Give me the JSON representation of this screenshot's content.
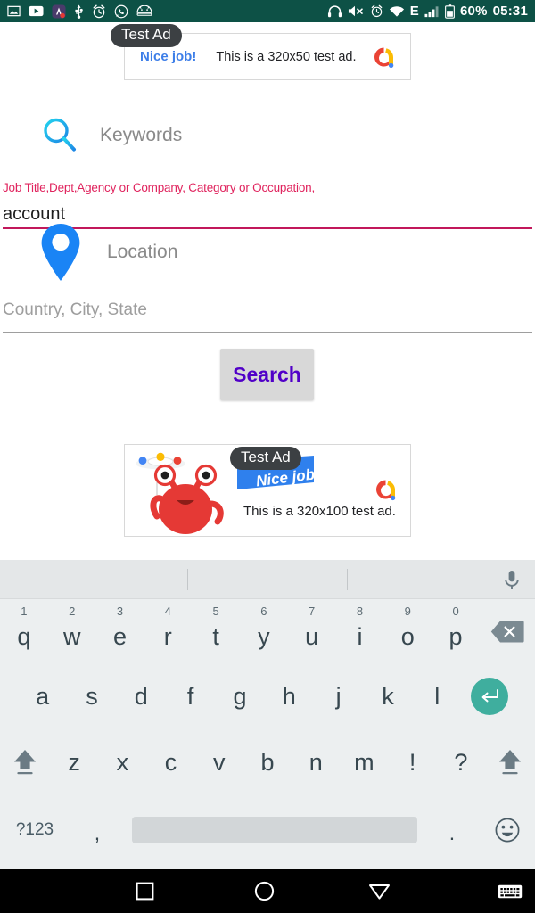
{
  "status_bar": {
    "background": "#0d5146",
    "left_icons": [
      "image-icon",
      "youtube-icon",
      "app-badge-icon",
      "usb-icon",
      "alarm-icon",
      "whatsapp-icon",
      "android-icon"
    ],
    "right_icons": [
      "headset-icon",
      "volume-mute-icon",
      "alarm-icon",
      "wifi-icon",
      "edge-network-icon",
      "signal-bars-icon",
      "battery-icon"
    ],
    "battery_percent": "60%",
    "clock": "05:31"
  },
  "ads": {
    "badge_label": "Test Ad",
    "top": {
      "nice_job": "Nice job!",
      "text": "This is a 320x50 test ad.",
      "logo": "admob-logo",
      "size": "320x50"
    },
    "bottom": {
      "nice_job": "Nice job!",
      "text": "This is a 320x100 test ad.",
      "logo": "admob-logo",
      "character": "red-monster-icon",
      "size": "320x100"
    }
  },
  "form": {
    "keywords": {
      "icon": "search-magnifier-icon",
      "label": "Keywords",
      "hint": "Job Title,Dept,Agency or Company, Category or Occupation,",
      "hint_color": "#e0245e",
      "value": "account",
      "underline_color": "#c2185b"
    },
    "location": {
      "icon": "map-pin-icon",
      "label": "Location",
      "placeholder": "Country, City, State",
      "value": "",
      "underline_color": "#9e9e9e"
    },
    "search_button": {
      "label": "Search",
      "text_color": "#5100c8",
      "background": "#d8d8d8"
    }
  },
  "keyboard": {
    "background": "#eceff0",
    "suggestion_strip": {
      "suggestions": [
        "",
        "",
        ""
      ],
      "mic_icon": "microphone-icon"
    },
    "row1": [
      {
        "key": "q",
        "num": "1"
      },
      {
        "key": "w",
        "num": "2"
      },
      {
        "key": "e",
        "num": "3"
      },
      {
        "key": "r",
        "num": "4"
      },
      {
        "key": "t",
        "num": "5"
      },
      {
        "key": "y",
        "num": "6"
      },
      {
        "key": "u",
        "num": "7"
      },
      {
        "key": "i",
        "num": "8"
      },
      {
        "key": "o",
        "num": "9"
      },
      {
        "key": "p",
        "num": "0"
      }
    ],
    "backspace_icon": "backspace-icon",
    "row2": [
      "a",
      "s",
      "d",
      "f",
      "g",
      "h",
      "j",
      "k",
      "l"
    ],
    "enter_icon": "enter-return-icon",
    "enter_color": "#3fae9e",
    "row3": [
      "z",
      "x",
      "c",
      "v",
      "b",
      "n",
      "m",
      "!",
      "?"
    ],
    "shift_icon": "shift-icon",
    "row4": {
      "symbols_label": "?123",
      "comma": ",",
      "space": "",
      "period": ".",
      "emoji_icon": "emoji-smiley-icon"
    }
  },
  "nav_bar": {
    "background": "#000000",
    "buttons": [
      "recents-square-icon",
      "home-circle-icon",
      "back-triangle-icon",
      "hide-keyboard-icon"
    ]
  }
}
